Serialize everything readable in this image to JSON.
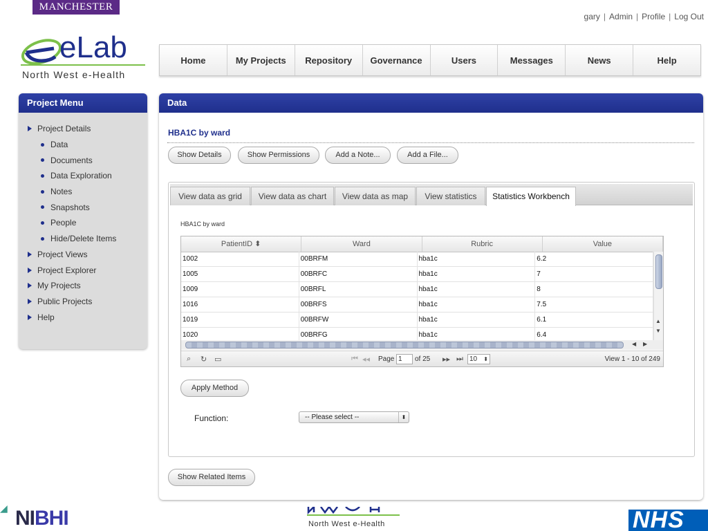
{
  "header": {
    "university_banner": "MANCHESTER",
    "user_links": [
      "gary",
      "Admin",
      "Profile",
      "Log Out"
    ],
    "logo_text": "eLab",
    "logo_subtitle": "North West e-Health"
  },
  "nav": [
    "Home",
    "My Projects",
    "Repository",
    "Governance",
    "Users",
    "Messages",
    "News",
    "Help"
  ],
  "sidebar": {
    "title": "Project Menu",
    "items": [
      {
        "label": "Project Details",
        "level": "top"
      },
      {
        "label": "Data",
        "level": "sub"
      },
      {
        "label": "Documents",
        "level": "sub"
      },
      {
        "label": "Data Exploration",
        "level": "sub"
      },
      {
        "label": "Notes",
        "level": "sub"
      },
      {
        "label": "Snapshots",
        "level": "sub"
      },
      {
        "label": "People",
        "level": "sub"
      },
      {
        "label": "Hide/Delete Items",
        "level": "sub"
      },
      {
        "label": "Project Views",
        "level": "top"
      },
      {
        "label": "Project Explorer",
        "level": "top"
      },
      {
        "label": "My Projects",
        "level": "top"
      },
      {
        "label": "Public Projects",
        "level": "top"
      },
      {
        "label": "Help",
        "level": "top"
      }
    ]
  },
  "main": {
    "panel_title": "Data",
    "item_title": "HBA1C by ward",
    "actions": [
      "Show Details",
      "Show Permissions",
      "Add a Note...",
      "Add a File..."
    ],
    "tabs": [
      "View data as grid",
      "View data as chart",
      "View data as map",
      "View statistics",
      "Statistics Workbench"
    ],
    "active_tab": "Statistics Workbench",
    "dataset_caption": "HBA1C by ward",
    "grid": {
      "columns": [
        "PatientID ⬍",
        "Ward",
        "Rubric",
        "Value"
      ],
      "rows": [
        [
          "1002",
          "00BRFM",
          "hba1c",
          "6.2"
        ],
        [
          "1005",
          "00BRFC",
          "hba1c",
          "7"
        ],
        [
          "1009",
          "00BRFL",
          "hba1c",
          "8"
        ],
        [
          "1016",
          "00BRFS",
          "hba1c",
          "7.5"
        ],
        [
          "1019",
          "00BRFW",
          "hba1c",
          "6.1"
        ],
        [
          "1020",
          "00BRFG",
          "hba1c",
          "6.4"
        ]
      ],
      "pager": {
        "page_label": "Page",
        "page_value": "1",
        "of_label": "of 25",
        "rows_per_page": "10",
        "view_text": "View 1 - 10 of 249"
      }
    },
    "apply_method_label": "Apply Method",
    "function_label": "Function:",
    "function_select_value": "-- Please select --",
    "related_items_label": "Show Related Items"
  },
  "footer": {
    "nibhi_prefix": "NI",
    "nibhi_suffix": "BHI",
    "nwe_text": "North West e-Health",
    "nhs_text": "NHS"
  },
  "colors": {
    "panel_header": "#1f2f8c",
    "item_title": "#1f2f8c",
    "nhs_blue": "#005eb8",
    "manchester_purple": "#5b2a86",
    "logo_green": "#7cc04a"
  }
}
